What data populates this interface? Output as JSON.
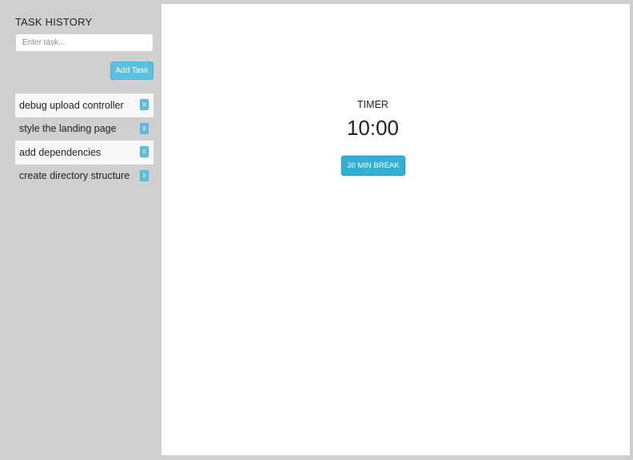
{
  "sidebar": {
    "title": "TASK HISTORY",
    "input": {
      "placeholder": "Enter task...",
      "value": ""
    },
    "add_button_label": "Add Task",
    "tasks": [
      {
        "label": "debug upload controller",
        "remove_label": "x"
      },
      {
        "label": "style the landing page",
        "remove_label": "x"
      },
      {
        "label": "add dependencies",
        "remove_label": "x"
      },
      {
        "label": "create directory structure",
        "remove_label": "x"
      }
    ]
  },
  "timer": {
    "label": "TIMER",
    "value": "10:00",
    "break_button_label": "30 MIN BREAK"
  },
  "colors": {
    "accent": "#5bc0de",
    "accent_dark": "#31b0d5",
    "sidebar_bg": "#cfcfcf",
    "main_bg": "#ffffff"
  }
}
